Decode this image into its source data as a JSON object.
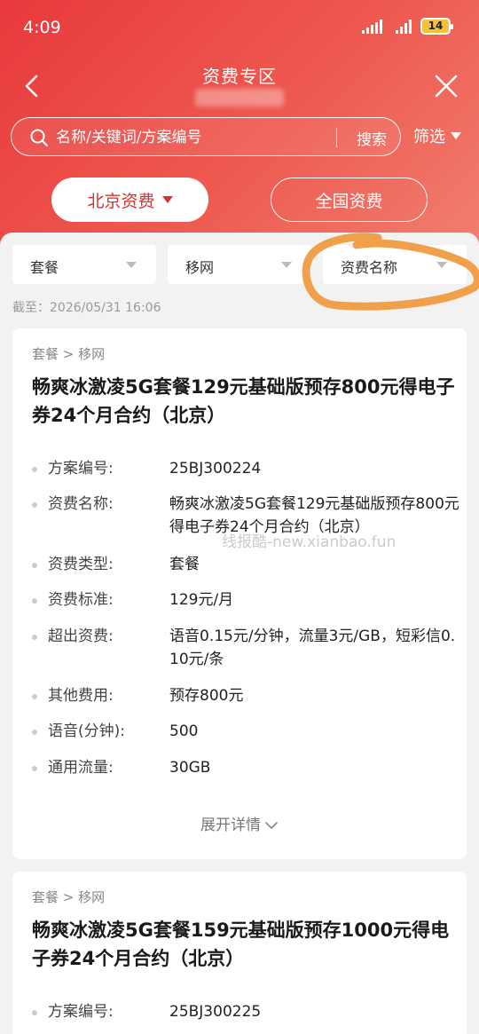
{
  "status": {
    "time": "4:09",
    "battery": "14"
  },
  "header": {
    "title": "资费专区",
    "search_placeholder": "名称/关键词/方案编号",
    "search_button": "搜索",
    "filter_label": "筛选"
  },
  "region_tabs": [
    {
      "label": "北京资费",
      "active": true
    },
    {
      "label": "全国资费",
      "active": false
    }
  ],
  "filters": [
    {
      "label": "套餐"
    },
    {
      "label": "移网"
    },
    {
      "label": "资费名称"
    }
  ],
  "timestamp": "截至：2026/05/31 16:06",
  "watermark": "线报酷-new.xianbao.fun",
  "cards": [
    {
      "breadcrumb": "套餐 > 移网",
      "title": "畅爽冰激凌5G套餐129元基础版预存800元得电子券24个月合约（北京）",
      "fields": [
        {
          "label": "方案编号:",
          "value": "25BJ300224"
        },
        {
          "label": "资费名称:",
          "value": "畅爽冰激凌5G套餐129元基础版预存800元得电子券24个月合约（北京）"
        },
        {
          "label": "资费类型:",
          "value": "套餐"
        },
        {
          "label": "资费标准:",
          "value": "129元/月"
        },
        {
          "label": "超出资费:",
          "value": "语音0.15元/分钟，流量3元/GB，短彩信0.10元/条"
        },
        {
          "label": "其他费用:",
          "value": "预存800元"
        },
        {
          "label": "语音(分钟):",
          "value": "500"
        },
        {
          "label": "通用流量:",
          "value": "30GB"
        }
      ],
      "expand_label": "展开详情"
    },
    {
      "breadcrumb": "套餐 > 移网",
      "title": "畅爽冰激凌5G套餐159元基础版预存1000元得电子券24个月合约（北京）",
      "fields": [
        {
          "label": "方案编号:",
          "value": "25BJ300225"
        }
      ]
    }
  ],
  "colors": {
    "brand_red": "#e8393c",
    "scribble_orange": "#f0a04a"
  }
}
